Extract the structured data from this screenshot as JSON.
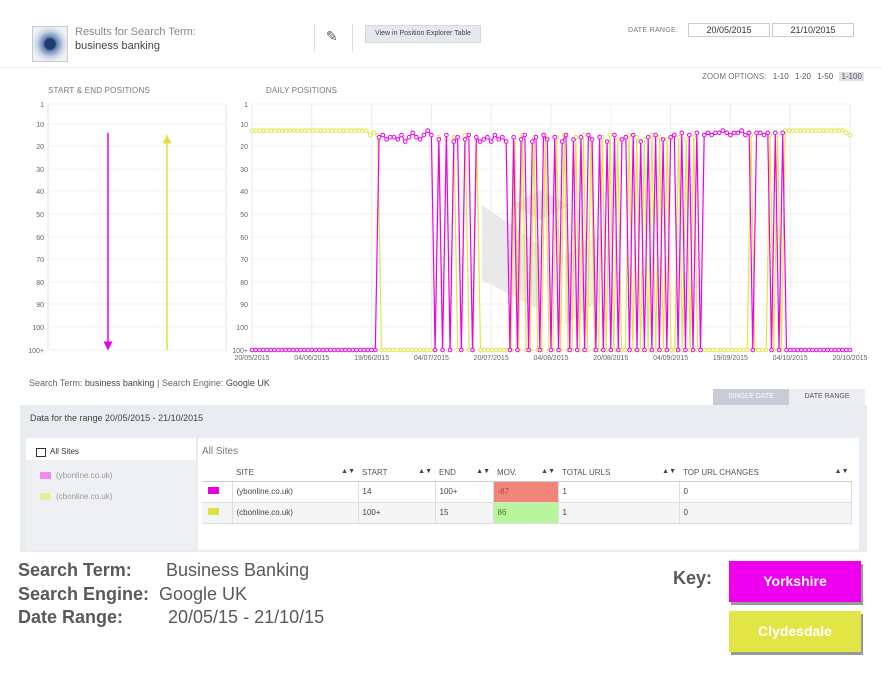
{
  "header": {
    "results_label": "Results for Search Term:",
    "search_term": "business banking",
    "explorer_button": "View in Position Explorer Table",
    "date_range_label": "DATE RANGE:",
    "date_from": "20/05/2015",
    "date_to": "21/10/2015"
  },
  "zoom": {
    "label": "ZOOM OPTIONS:",
    "options": [
      "1-10",
      "1-20",
      "1-50",
      "1-100"
    ],
    "active": "1-100"
  },
  "colors": {
    "site1": "#ee00ee",
    "site2": "#e1e646",
    "negative": "#f28579",
    "positive": "#b9f59a"
  },
  "chart_data": [
    {
      "type": "arrow",
      "title": "START & END POSITIONS",
      "y_ticks": [
        "1",
        "10",
        "20",
        "30",
        "40",
        "50",
        "60",
        "70",
        "80",
        "90",
        "100",
        "100+"
      ],
      "series": [
        {
          "name": "(ybonline.co.uk)",
          "start": 14,
          "end": "100+"
        },
        {
          "name": "(cbonline.co.uk)",
          "start": "100+",
          "end": 15
        }
      ]
    },
    {
      "type": "line",
      "title": "DAILY POSITIONS",
      "y_ticks": [
        "1",
        "10",
        "20",
        "30",
        "40",
        "50",
        "60",
        "70",
        "80",
        "90",
        "100",
        "100+"
      ],
      "x_ticks": [
        "20/05/2015",
        "04/06/2015",
        "19/06/2015",
        "04/07/2015",
        "20/07/2015",
        "04/08/2015",
        "20/08/2015",
        "04/09/2015",
        "19/09/2015",
        "04/10/2015",
        "20/10/2015"
      ],
      "series": [
        {
          "name": "(ybonline.co.uk)",
          "values": [
            "100+",
            "100+",
            "100+",
            "100+",
            "100+",
            "100+",
            "100+",
            "100+",
            "100+",
            "100+",
            "100+",
            "100+",
            "100+",
            "100+",
            "100+",
            "100+",
            "100+",
            "100+",
            "100+",
            "100+",
            "100+",
            "100+",
            "100+",
            "100+",
            "100+",
            "100+",
            "100+",
            "100+",
            "100+",
            "100+",
            "100+",
            "100+",
            "100+",
            "100+",
            16,
            15,
            17,
            16,
            16,
            17,
            15,
            18,
            16,
            14,
            16,
            17,
            15,
            13,
            15,
            "100+",
            17,
            "100+",
            15,
            "100+",
            18,
            16,
            "100+",
            17,
            15,
            "100+",
            16,
            18,
            17,
            16,
            18,
            15,
            17,
            16,
            18,
            "100+",
            16,
            "100+",
            17,
            15,
            "100+",
            18,
            16,
            "100+",
            15,
            17,
            "100+",
            16,
            "100+",
            18,
            15,
            "100+",
            17,
            "100+",
            16,
            "100+",
            15,
            17,
            "100+",
            16,
            "100+",
            18,
            "100+",
            15,
            "100+",
            17,
            16,
            "100+",
            15,
            "100+",
            18,
            "100+",
            16,
            "100+",
            15,
            "100+",
            17,
            "100+",
            16,
            15,
            "100+",
            14,
            "100+",
            15,
            "100+",
            14,
            "100+",
            15,
            14,
            15,
            14,
            14,
            13,
            14,
            15,
            14,
            14,
            13,
            15,
            14,
            "100+",
            14,
            14,
            15,
            14,
            "100+",
            14,
            "100+",
            14,
            "100+",
            "100+",
            "100+",
            "100+",
            "100+",
            "100+",
            "100+",
            "100+",
            "100+",
            "100+",
            "100+",
            "100+",
            "100+",
            "100+",
            "100+",
            "100+",
            "100+",
            "100+"
          ]
        },
        {
          "name": "(cbonline.co.uk)",
          "values": [
            13,
            13,
            13,
            13,
            13,
            13,
            13,
            13,
            13,
            13,
            13,
            13,
            13,
            13,
            13,
            13,
            13,
            13,
            13,
            13,
            13,
            13,
            13,
            13,
            13,
            13,
            13,
            13,
            13,
            13,
            13,
            15,
            14,
            15,
            "100+",
            "100+",
            "100+",
            "100+",
            "100+",
            "100+",
            "100+",
            "100+",
            "100+",
            "100+",
            "100+",
            "100+",
            "100+",
            "100+",
            "100+",
            16,
            "100+",
            17,
            "100+",
            16,
            "100+",
            "100+",
            15,
            "100+",
            "100+",
            17,
            "100+",
            "100+",
            "100+",
            "100+",
            "100+",
            "100+",
            "100+",
            "100+",
            "100+",
            17,
            "100+",
            15,
            "100+",
            "100+",
            16,
            "100+",
            "100+",
            15,
            "100+",
            "100+",
            16,
            "100+",
            15,
            "100+",
            "100+",
            16,
            "100+",
            15,
            "100+",
            17,
            "100+",
            "100+",
            16,
            "100+",
            15,
            "100+",
            17,
            "100+",
            "100+",
            15,
            "100+",
            16,
            "100+",
            17,
            "100+",
            15,
            "100+",
            16,
            "100+",
            17,
            "100+",
            "100+",
            16,
            "100+",
            17,
            "100+",
            16,
            "100+",
            "100+",
            "100+",
            "100+",
            "100+",
            "100+",
            "100+",
            "100+",
            "100+",
            "100+",
            "100+",
            "100+",
            "100+",
            "100+",
            15,
            "100+",
            "100+",
            "100+",
            "100+",
            15,
            "100+",
            15,
            "100+",
            13,
            13,
            13,
            13,
            13,
            13,
            13,
            13,
            13,
            13,
            13,
            13,
            13,
            13,
            13,
            13,
            14,
            15
          ]
        }
      ]
    }
  ],
  "search_info": {
    "term_label": "Search Term:",
    "term": "business banking",
    "separator": "|",
    "engine_label": "Search Engine:",
    "engine": "Google UK"
  },
  "tabs": {
    "single": "SINGLE DATE",
    "range": "DATE RANGE"
  },
  "panel": {
    "heading": "Data for the range 20/05/2015 - 21/10/2015",
    "all_sites_checkbox": "All Sites",
    "sites": [
      "(ybonline.co.uk)",
      "(cbonline.co.uk)"
    ],
    "table_title": "All Sites",
    "columns": [
      "SITE",
      "START",
      "END",
      "MOV.",
      "TOTAL URLS",
      "TOP URL CHANGES"
    ],
    "rows": [
      {
        "site": "(ybonline.co.uk)",
        "start": "14",
        "end": "100+",
        "mov": "-87",
        "total": "1",
        "changes": "0"
      },
      {
        "site": "(cbonline.co.uk)",
        "start": "100+",
        "end": "15",
        "mov": "86",
        "total": "1",
        "changes": "0"
      }
    ]
  },
  "summary": {
    "term_label": "Search Term:",
    "term": "Business Banking",
    "engine_label": "Search Engine:",
    "engine": "Google UK",
    "range_label": "Date Range:",
    "range": "20/05/15 - 21/10/15"
  },
  "key": {
    "label": "Key:",
    "items": [
      "Yorkshire",
      "Clydesdale"
    ]
  }
}
